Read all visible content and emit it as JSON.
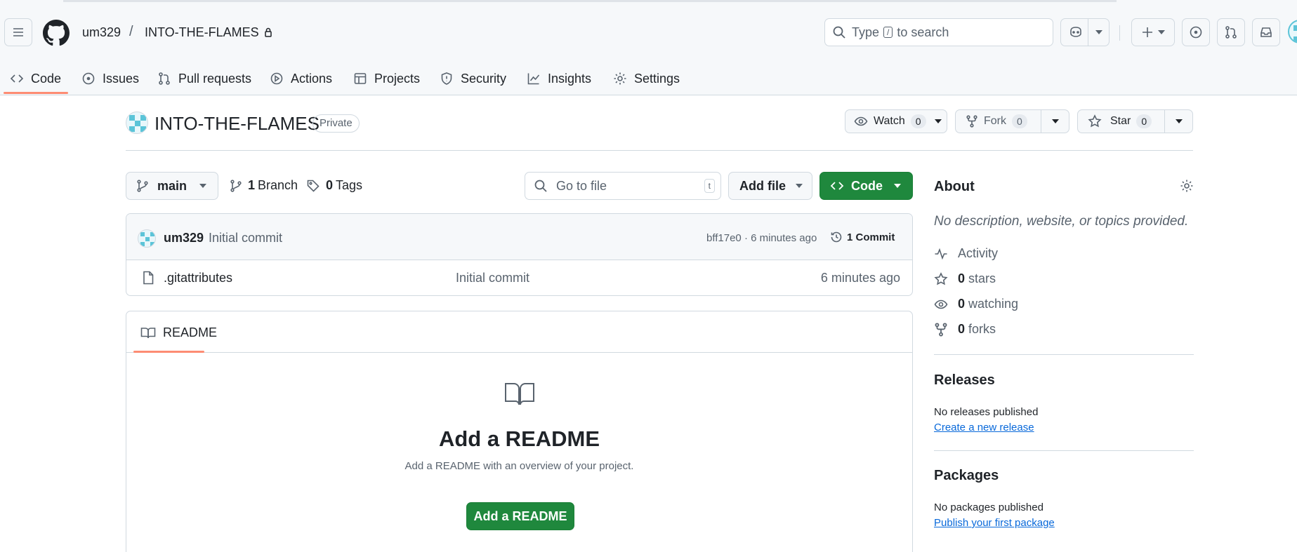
{
  "header": {
    "owner": "um329",
    "separator": "/",
    "repo": "INTO-THE-FLAMES",
    "search": {
      "prefix": "Type",
      "key": "/",
      "suffix": "to search"
    }
  },
  "tabs": [
    {
      "label": "Code",
      "icon": "code-icon",
      "active": true
    },
    {
      "label": "Issues",
      "icon": "issue-icon"
    },
    {
      "label": "Pull requests",
      "icon": "pull-request-icon"
    },
    {
      "label": "Actions",
      "icon": "play-icon"
    },
    {
      "label": "Projects",
      "icon": "table-icon"
    },
    {
      "label": "Security",
      "icon": "shield-icon"
    },
    {
      "label": "Insights",
      "icon": "graph-icon"
    },
    {
      "label": "Settings",
      "icon": "gear-icon"
    }
  ],
  "repo": {
    "title": "INTO-THE-FLAMES",
    "visibility": "Private",
    "watch": {
      "label": "Watch",
      "count": "0"
    },
    "fork": {
      "label": "Fork",
      "count": "0"
    },
    "star": {
      "label": "Star",
      "count": "0"
    }
  },
  "toolbar": {
    "branch": "main",
    "branches_count": "1",
    "branches_label": "Branch",
    "tags_count": "0",
    "tags_label": "Tags",
    "goto_placeholder": "Go to file",
    "goto_key": "t",
    "add_file": "Add file",
    "code": "Code"
  },
  "latest_commit": {
    "author": "um329",
    "message": "Initial commit",
    "hash_time": "bff17e0 · 6 minutes ago",
    "commits": "1 Commit"
  },
  "files": [
    {
      "name": ".gitattributes",
      "message": "Initial commit",
      "time": "6 minutes ago"
    }
  ],
  "readme": {
    "tab": "README",
    "heading": "Add a README",
    "description": "Add a README with an overview of your project.",
    "button": "Add a README"
  },
  "about": {
    "title": "About",
    "description": "No description, website, or topics provided.",
    "activity": "Activity",
    "stars_count": "0",
    "stars_label": "stars",
    "watching_count": "0",
    "watching_label": "watching",
    "forks_count": "0",
    "forks_label": "forks"
  },
  "releases": {
    "title": "Releases",
    "empty": "No releases published",
    "link": "Create a new release"
  },
  "packages": {
    "title": "Packages",
    "empty": "No packages published",
    "link": "Publish your first package"
  },
  "colors": {
    "accent_green": "#1f883d",
    "tab_underline": "#fd8c73",
    "link": "#0969da",
    "border": "#d1d9e0"
  }
}
